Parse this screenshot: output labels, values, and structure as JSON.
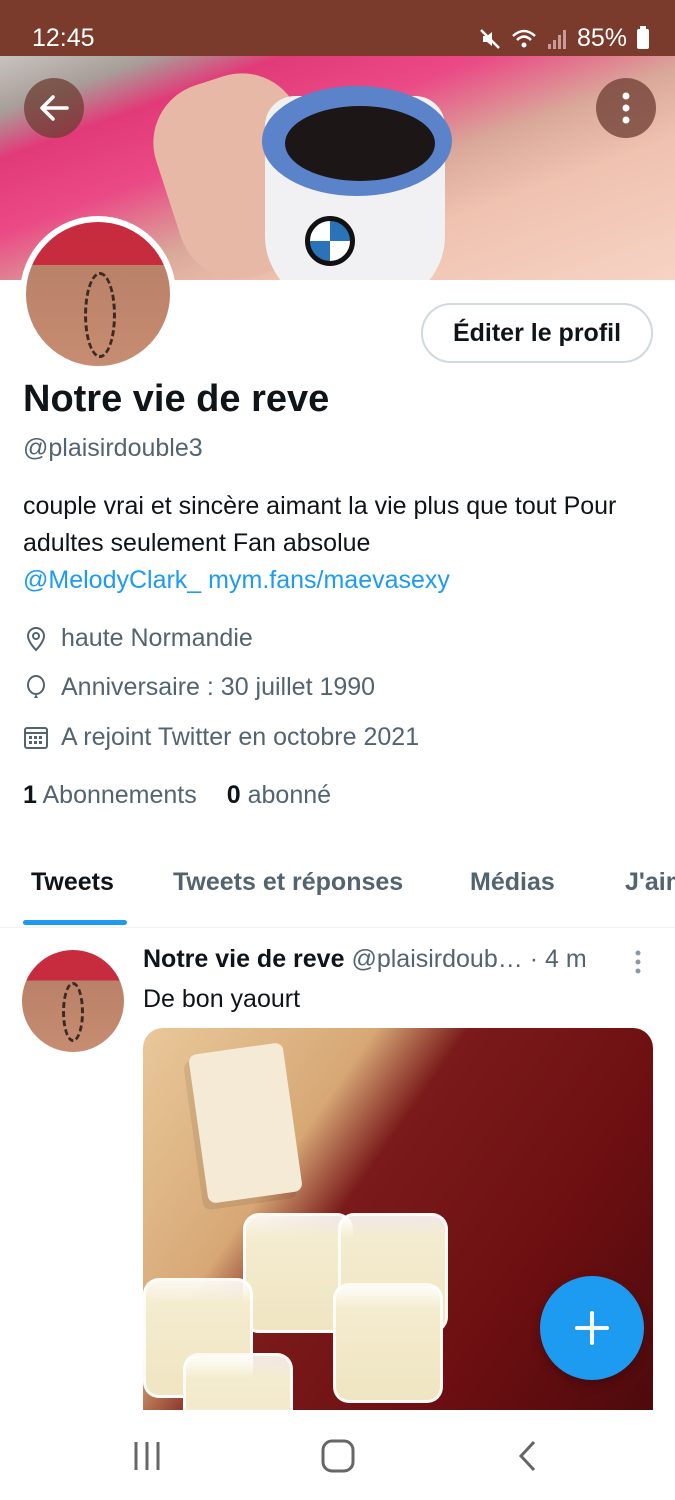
{
  "status_bar": {
    "time": "12:45",
    "battery": "85%"
  },
  "profile": {
    "edit_button": "Éditer le profil",
    "name": "Notre vie de reve",
    "handle": "@plaisirdouble3",
    "bio_text": "couple vrai et sincère aimant la vie plus que tout  Pour adultes seulement Fan absolue",
    "bio_mention": "@MelodyClark_",
    "bio_link": "mym.fans/maevasexy",
    "location": "haute Normandie",
    "birthday": "Anniversaire : 30 juillet 1990",
    "joined": "A rejoint Twitter en octobre 2021",
    "following_count": "1",
    "following_label": "Abonnements",
    "followers_count": "0",
    "followers_label": "abonné"
  },
  "tabs": [
    {
      "label": "Tweets",
      "active": true
    },
    {
      "label": "Tweets et réponses",
      "active": false
    },
    {
      "label": "Médias",
      "active": false
    },
    {
      "label": "J'aime",
      "active": false
    }
  ],
  "tweet": {
    "author": "Notre vie de reve",
    "handle": "@plaisirdoub…",
    "time": "· 4 m",
    "text": "De bon yaourt"
  },
  "colors": {
    "accent": "#1d9bf0",
    "status_bar": "#7a3a2c",
    "text": "#0f1419",
    "muted": "#536471"
  },
  "icons": {
    "back": "arrow-left-icon",
    "more": "more-vertical-icon",
    "location": "location-pin-icon",
    "birthday": "balloon-icon",
    "joined": "calendar-icon",
    "compose": "plus-icon"
  }
}
